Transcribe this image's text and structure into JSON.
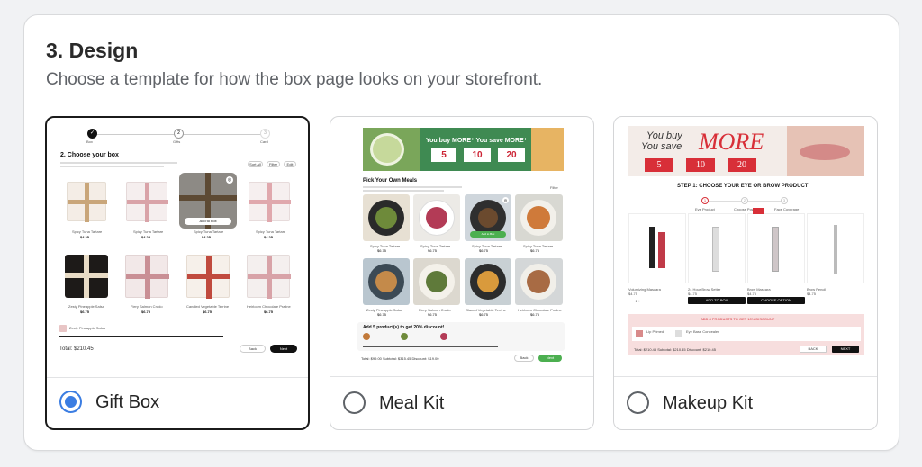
{
  "section": {
    "title": "3. Design",
    "subtitle": "Choose a template for how the box page looks on your storefront."
  },
  "options": [
    {
      "label": "Gift Box",
      "selected": true
    },
    {
      "label": "Meal Kit",
      "selected": false
    },
    {
      "label": "Makeup Kit",
      "selected": false
    }
  ],
  "gift_preview": {
    "steps": [
      "Box",
      "Gifts",
      "Card"
    ],
    "heading": "2. Choose your box",
    "filters": [
      "Sort All",
      "Filter",
      "Edit"
    ],
    "add_label": "Add to box",
    "products_row1": [
      {
        "name": "Spicy Tuna Tartare",
        "price": "$4.25"
      },
      {
        "name": "Spicy Tuna Tartare",
        "price": "$4.25"
      },
      {
        "name": "Spicy Tuna Tartare",
        "price": "$4.25"
      },
      {
        "name": "Spicy Tuna Tartare",
        "price": "$4.25"
      }
    ],
    "products_row2": [
      {
        "name": "Zesty Pineapple Salsa",
        "price": "$6.75"
      },
      {
        "name": "Fiery Salmon Crudo",
        "price": "$6.75"
      },
      {
        "name": "Candied Vegetable Terrine",
        "price": "$6.75"
      },
      {
        "name": "Heirloom Chocolate Praline",
        "price": "$6.75"
      }
    ],
    "selected_item": "Zesty Pineapple Salsa",
    "total": "Total: $210.45",
    "back": "Back",
    "next": "Next"
  },
  "meal_preview": {
    "banner": "You buy MORE⁺ You save MORE⁺",
    "tiers": [
      "5",
      "10",
      "20"
    ],
    "heading": "Pick Your Own Meals",
    "filter": "Filter",
    "meals_row1": [
      {
        "name": "Spicy Tuna Tartare",
        "price": "$6.75"
      },
      {
        "name": "Spicy Tuna Tartare",
        "price": "$6.75"
      },
      {
        "name": "Spicy Tuna Tartare",
        "price": "$6.75"
      },
      {
        "name": "Spicy Tuna Tartare",
        "price": "$6.75"
      }
    ],
    "meals_row2": [
      {
        "name": "Zesty Pineapple Salsa",
        "price": "$6.75"
      },
      {
        "name": "Fiery Salmon Crudo",
        "price": "$6.75"
      },
      {
        "name": "Glazed Vegetable Terrine",
        "price": "$6.75"
      },
      {
        "name": "Heirloom Chocolate Praline",
        "price": "$6.75"
      }
    ],
    "add_label": "Add to Box",
    "discount": "Add 5 product(s) to get 20% discount!",
    "totals": "Total: $99.00   Subtotal: $315.45   Discount: $19.00",
    "back": "Back",
    "next": "Next"
  },
  "makeup_preview": {
    "banner_line1": "You buy",
    "banner_line2": "You save",
    "banner_more": "MORE",
    "tiers": [
      "5",
      "10",
      "20"
    ],
    "heading": "STEP 1: CHOOSE YOUR EYE OR BROW PRODUCT",
    "steps": [
      "Eye Product",
      "Choose Powder",
      "Face Coverage"
    ],
    "products": [
      {
        "name": "Volumizing Mascara",
        "price": "$4.75"
      },
      {
        "name": "24 Hour Brow Setter",
        "price": "$4.75"
      },
      {
        "name": "Brow Mascara",
        "price": "$4.75"
      },
      {
        "name": "Brow Pencil",
        "price": "$4.75"
      }
    ],
    "add_to_box": "ADD TO BOX",
    "choose_option": "CHOOSE OPTION",
    "discount": "ADD 8 PRODUCTS TO GET 10% DISCOUNT",
    "items": [
      "Lip Primed",
      "Eye Base Concealer"
    ],
    "totals": "Total: $210.45   Subtotal: $210.45   Discount: $210.45",
    "back": "BACK",
    "next": "NEXT"
  },
  "colors": {
    "accent": "#3b7de2",
    "meal_banner": "#3f8a52",
    "makeup_banner": "#d82f38",
    "makeup_discount_bg": "#f7dede"
  }
}
